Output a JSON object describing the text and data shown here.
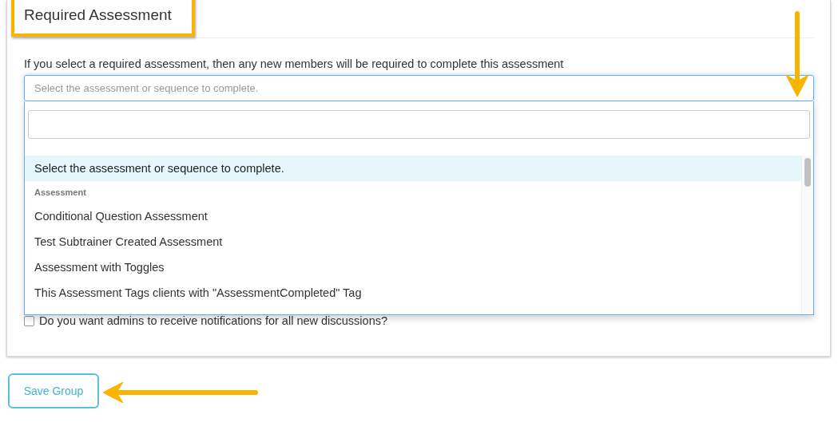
{
  "section": {
    "title": "Required Assessment",
    "description": "If you select a required assessment, then any new members will be required to complete this assessment"
  },
  "select": {
    "placeholder": "Select the assessment or sequence to complete.",
    "open": true
  },
  "options": [
    {
      "kind": "option",
      "label": "Select the assessment or sequence to complete.",
      "selected": true
    },
    {
      "kind": "group",
      "label": "Assessment"
    },
    {
      "kind": "option",
      "label": "Conditional Question Assessment",
      "selected": false
    },
    {
      "kind": "option",
      "label": "Test Subtrainer Created Assessment",
      "selected": false
    },
    {
      "kind": "option",
      "label": "Assessment with Toggles",
      "selected": false
    },
    {
      "kind": "option",
      "label": "This Assessment Tags clients with \"AssessmentCompleted\" Tag",
      "selected": false
    }
  ],
  "notify_checkbox": {
    "label": "Do you want admins to receive notifications for all new discussions?",
    "checked": false
  },
  "save_button": {
    "label": "Save Group"
  }
}
